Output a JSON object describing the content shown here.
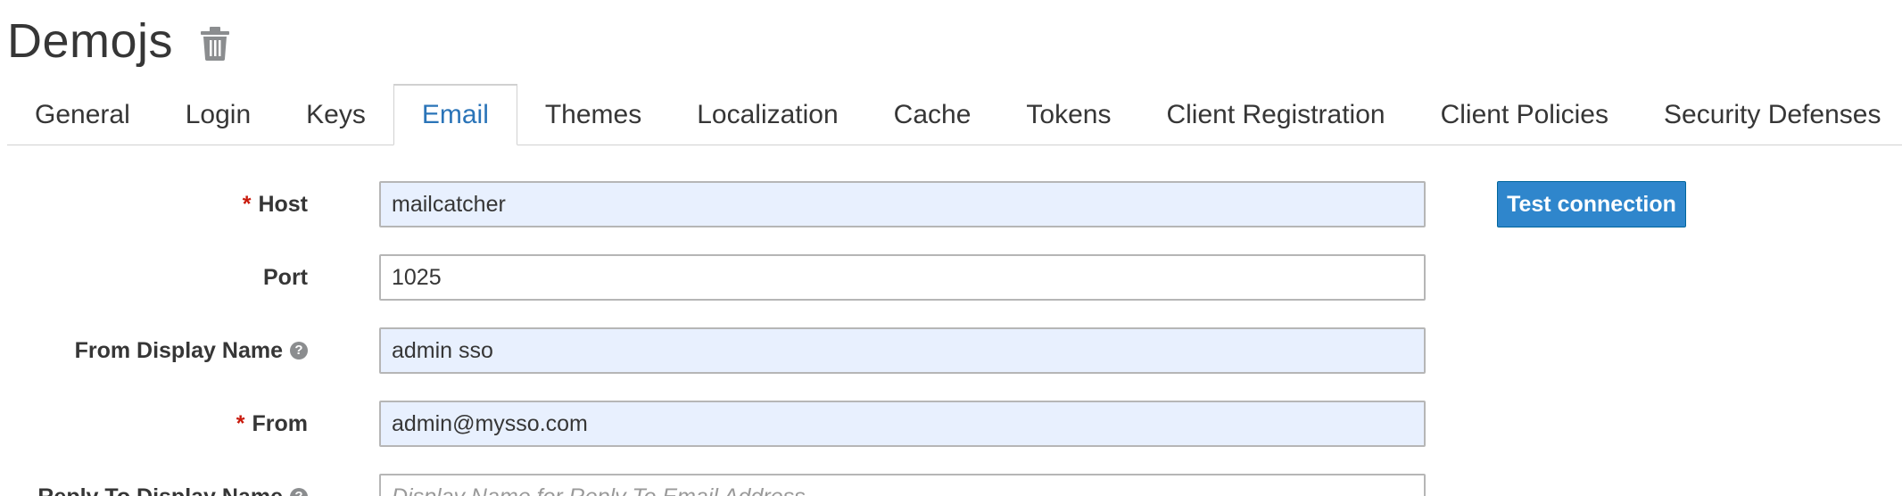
{
  "header": {
    "realm_title": "Demojs",
    "delete_icon": "trash-icon"
  },
  "tabs": [
    {
      "label": "General",
      "active": false
    },
    {
      "label": "Login",
      "active": false
    },
    {
      "label": "Keys",
      "active": false
    },
    {
      "label": "Email",
      "active": true
    },
    {
      "label": "Themes",
      "active": false
    },
    {
      "label": "Localization",
      "active": false
    },
    {
      "label": "Cache",
      "active": false
    },
    {
      "label": "Tokens",
      "active": false
    },
    {
      "label": "Client Registration",
      "active": false
    },
    {
      "label": "Client Policies",
      "active": false
    },
    {
      "label": "Security Defenses",
      "active": false
    }
  ],
  "form": {
    "required_marker": "*",
    "help_glyph": "?",
    "host": {
      "label": "Host",
      "value": "mailcatcher",
      "required": true
    },
    "port": {
      "label": "Port",
      "value": "1025",
      "required": false
    },
    "from_display_name": {
      "label": "From Display Name",
      "value": "admin sso",
      "help_icon": "question-circle-icon"
    },
    "from": {
      "label": "From",
      "value": "admin@mysso.com",
      "required": true
    },
    "reply_to_display_name": {
      "label": "Reply To Display Name",
      "value": "",
      "placeholder": "Display Name for Reply To Email Address",
      "help_icon": "question-circle-icon"
    }
  },
  "actions": {
    "test_connection_label": "Test connection"
  },
  "colors": {
    "accent": "#2a74b8",
    "button": "#2f86cc",
    "required": "#c9190b",
    "autofill_bg": "#e8f0fe"
  }
}
